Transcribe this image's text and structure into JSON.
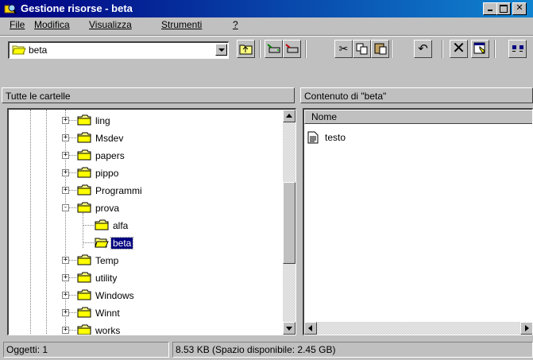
{
  "window": {
    "title": "Gestione risorse - beta",
    "icon": "explorer-icon",
    "controls": [
      "minimize-icon",
      "maximize-icon",
      "close-icon"
    ]
  },
  "menu": {
    "items": [
      {
        "label": "File",
        "hotkey": "F"
      },
      {
        "label": "Modifica",
        "hotkey": "M"
      },
      {
        "label": "Visualizza",
        "hotkey": "V"
      },
      {
        "label": "Strumenti",
        "hotkey": "S"
      },
      {
        "label": "?",
        "hotkey": "?"
      }
    ]
  },
  "toolbar": {
    "address_value": "beta",
    "buttons": [
      "up-folder-icon",
      "map-drive-icon",
      "disconnect-drive-icon",
      "cut-icon",
      "copy-icon",
      "paste-icon",
      "undo-icon",
      "delete-icon",
      "properties-icon",
      "large-icons-view-icon"
    ]
  },
  "tree_pane": {
    "header": "Tutte le cartelle",
    "items": [
      {
        "label": "ling",
        "level": 1,
        "expander": "+"
      },
      {
        "label": "Msdev",
        "level": 1,
        "expander": "+"
      },
      {
        "label": "papers",
        "level": 1,
        "expander": "+"
      },
      {
        "label": "pippo",
        "level": 1,
        "expander": "+"
      },
      {
        "label": "Programmi",
        "level": 1,
        "expander": "+"
      },
      {
        "label": "prova",
        "level": 1,
        "expander": "-"
      },
      {
        "label": "alfa",
        "level": 2,
        "expander": ""
      },
      {
        "label": "beta",
        "level": 2,
        "expander": "",
        "selected": true
      },
      {
        "label": "Temp",
        "level": 1,
        "expander": "+"
      },
      {
        "label": "utility",
        "level": 1,
        "expander": "+"
      },
      {
        "label": "Windows",
        "level": 1,
        "expander": "+"
      },
      {
        "label": "Winnt",
        "level": 1,
        "expander": "+"
      },
      {
        "label": "works",
        "level": 1,
        "expander": "+"
      }
    ]
  },
  "content_pane": {
    "header": "Contenuto di \"beta\"",
    "column_name": "Nome",
    "files": [
      {
        "label": "testo",
        "icon": "text-file-icon"
      }
    ]
  },
  "status": {
    "objects": "Oggetti: 1",
    "size": "8.53 KB (Spazio disponibile: 2.45 GB)"
  },
  "colors": {
    "title_start": "#000080",
    "title_end": "#1084d0",
    "selection": "#000080",
    "face": "#c0c0c0"
  }
}
